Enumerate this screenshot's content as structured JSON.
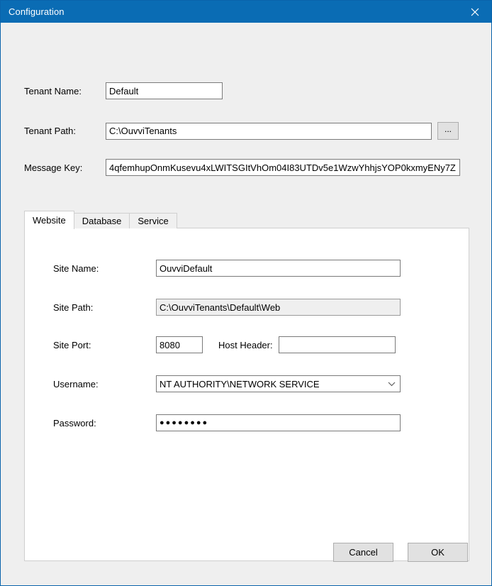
{
  "window": {
    "title": "Configuration",
    "close_icon": "close-icon",
    "titlebar_color": "#0a6cb4"
  },
  "form": {
    "tenant_name": {
      "label": "Tenant Name:",
      "value": "Default"
    },
    "tenant_path": {
      "label": "Tenant Path:",
      "value": "C:\\OuvviTenants",
      "browse_label": "..."
    },
    "message_key": {
      "label": "Message Key:",
      "value": "4qfemhupOnmKusevu4xLWITSGItVhOm04I83UTDv5e1WzwYhhjsYOP0kxmyENy7Z"
    }
  },
  "tabs": [
    {
      "label": "Website",
      "active": true
    },
    {
      "label": "Database",
      "active": false
    },
    {
      "label": "Service",
      "active": false
    }
  ],
  "website_tab": {
    "site_name": {
      "label": "Site Name:",
      "value": "OuvviDefault"
    },
    "site_path": {
      "label": "Site Path:",
      "value": "C:\\OuvviTenants\\Default\\Web",
      "readonly": true
    },
    "site_port": {
      "label": "Site Port:",
      "value": "8080"
    },
    "host_header": {
      "label": "Host Header:",
      "value": "",
      "placeholder": ""
    },
    "username": {
      "label": "Username:",
      "value": "NT AUTHORITY\\NETWORK SERVICE",
      "chevron_icon": "chevron-down-icon"
    },
    "password": {
      "label": "Password:",
      "value": "●●●●●●●●"
    }
  },
  "footer": {
    "cancel_label": "Cancel",
    "ok_label": "OK"
  }
}
